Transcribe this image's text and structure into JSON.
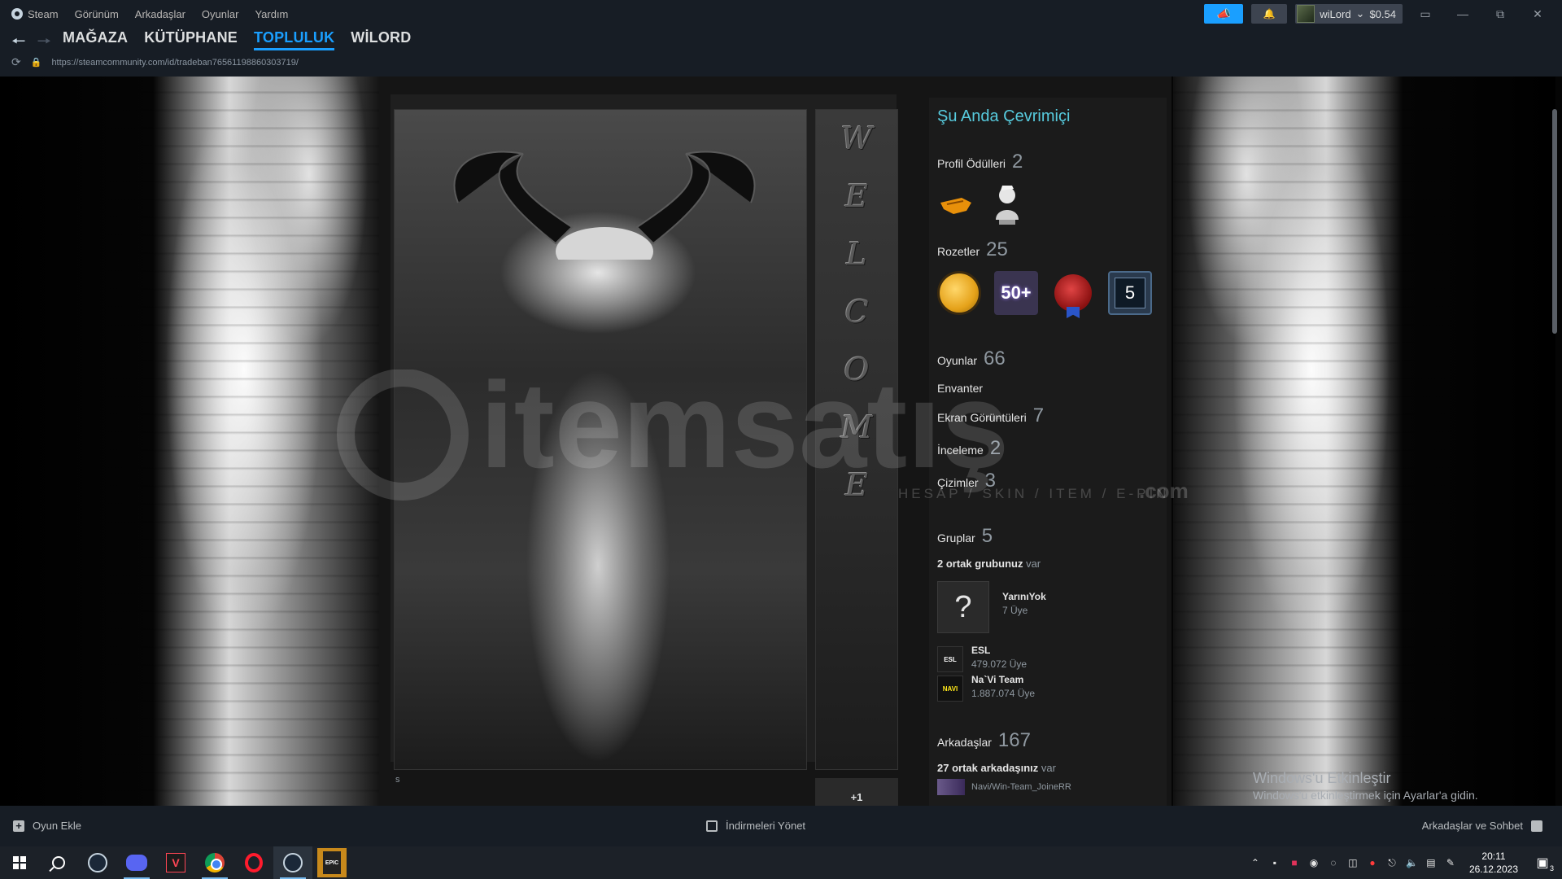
{
  "titlebar": {
    "menu": [
      "Steam",
      "Görünüm",
      "Arkadaşlar",
      "Oyunlar",
      "Yardım"
    ],
    "user_name": "wiLord",
    "wallet": "$0.54"
  },
  "nav": {
    "tabs": [
      {
        "label": "MAĞAZA",
        "active": false
      },
      {
        "label": "KÜTÜPHANE",
        "active": false
      },
      {
        "label": "TOPLULUK",
        "active": true
      },
      {
        "label": "WİLORD",
        "active": false
      }
    ],
    "url": "https://steamcommunity.com/id/tradeban76561198860303719/"
  },
  "showcase": {
    "welcome_letters": [
      "W",
      "E",
      "L",
      "C",
      "O",
      "M",
      "E"
    ],
    "caption": "s",
    "plus_one": "+1"
  },
  "sidebar": {
    "online_status": "Şu Anda Çevrimiçi",
    "profile_awards": {
      "label": "Profil Ödülleri",
      "count": "2"
    },
    "badges": {
      "label": "Rozetler",
      "count": "25",
      "badge_50": "50+",
      "badge_5": "5"
    },
    "games": {
      "label": "Oyunlar",
      "count": "66"
    },
    "inventory": {
      "label": "Envanter"
    },
    "screenshots": {
      "label": "Ekran Görüntüleri",
      "count": "7"
    },
    "reviews": {
      "label": "İnceleme",
      "count": "2"
    },
    "artwork": {
      "label": "Çizimler",
      "count": "3"
    },
    "groups": {
      "label": "Gruplar",
      "count": "5",
      "common_bold": "2 ortak grubunuz",
      "common_rest": " var",
      "items": [
        {
          "name": "YarınıYok",
          "members": "7 Üye",
          "avatar_text": "?"
        },
        {
          "name": "ESL",
          "members": "479.072 Üye",
          "avatar_text": "ESL"
        },
        {
          "name": "Na`Vi Team",
          "members": "1.887.074 Üye",
          "avatar_text": "NAVI"
        }
      ]
    },
    "friends": {
      "label": "Arkadaşlar",
      "count": "167",
      "common_bold": "27 ortak arkadaşınız",
      "common_rest": " var",
      "first_friend": "Navi/Win-Team_JoineRR"
    }
  },
  "watermark": {
    "brand": "itemsatış",
    "tagline": "HESAP / SKIN / ITEM / E-PIN",
    "suffix": ".com"
  },
  "activation": {
    "title": "Windows'u Etkinleştir",
    "subtitle": "Windows'u etkinleştirmek için Ayarlar'a gidin."
  },
  "bottombar": {
    "add_game": "Oyun Ekle",
    "downloads": "İndirmeleri Yönet",
    "friends_chat": "Arkadaşlar ve Sohbet"
  },
  "taskbar": {
    "time": "20:11",
    "date": "26.12.2023",
    "notification_count": "3",
    "epic_label": "EPIC"
  },
  "colors": {
    "accent": "#1a9fff",
    "online": "#57cbde",
    "steam_bar": "#171d25"
  }
}
